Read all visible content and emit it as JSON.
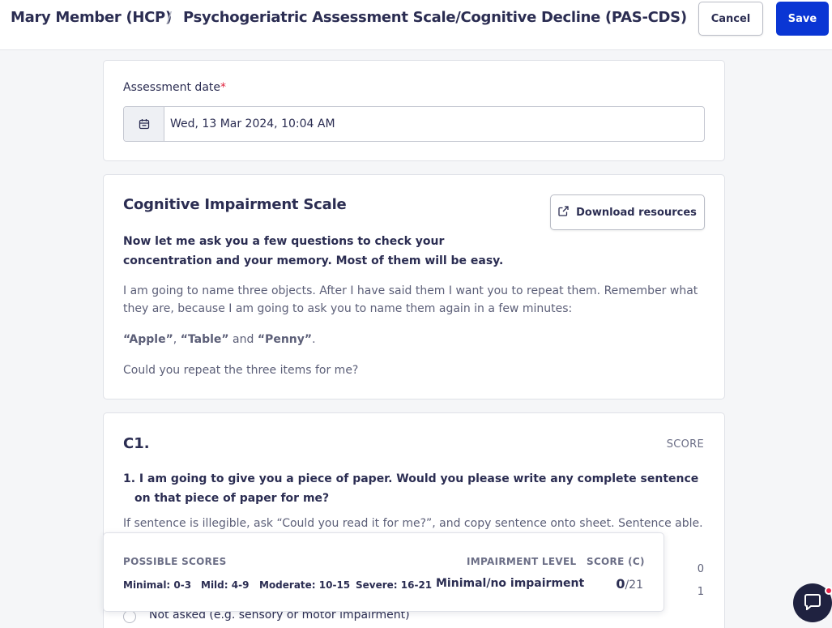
{
  "header": {
    "patient": "Mary Member (HCP)",
    "separator": "/",
    "form_title": "Psychogeriatric Assessment Scale/Cognitive Decline (PAS-CDS)",
    "cancel_label": "Cancel",
    "save_label": "Save"
  },
  "assessment": {
    "label": "Assessment date",
    "required_mark": "*",
    "value": "Wed, 13 Mar 2024, 10:04 AM",
    "icon": "calendar-icon"
  },
  "scale": {
    "title": "Cognitive Impairment Scale",
    "download_label": "Download resources",
    "download_icon": "external-link-icon",
    "intro": "Now let me ask you a few questions to check your concentration and your memory. Most of them will be easy.",
    "paragraph1": "I am going to name three objects. After I have said them I want you to repeat them. Remember what they are, because I am going to ask you to name them again in a few minutes:",
    "objects": [
      "“Apple”",
      "“Table”",
      "“Penny”"
    ],
    "joiner_comma": ", ",
    "joiner_and": " and ",
    "end_punct": ".",
    "paragraph3": "Could you repeat the three items for me?"
  },
  "c1": {
    "title": "C1.",
    "score_header": "SCORE",
    "question": "1. I am going to give you a piece of paper. Would you please write any complete sentence on that piece of paper for me?",
    "instruction": "If sentence is illegible, ask “Could you read it for me?”, and copy sentence onto sheet. Sentence                                                                                           able.",
    "option_scores": [
      "0",
      "1"
    ],
    "option_not_asked": "Not asked (e.g. sensory or motor impairment)"
  },
  "scores_panel": {
    "possible_header": "POSSIBLE SCORES",
    "impairment_header": "IMPAIRMENT LEVEL",
    "score_header": "SCORE (C)",
    "ranges": [
      "Minimal: 0-3",
      "Mild: 4-9",
      "Moderate: 10-15",
      "Severe: 16-21"
    ],
    "impairment_level": "Minimal/no impairment",
    "score": "0",
    "total": "/21"
  },
  "colors": {
    "primary": "#0a36d4",
    "text": "#2b2d52",
    "muted": "#5c5f78",
    "required": "#e0253f",
    "chat": "#1f2240"
  },
  "chat": {
    "icon": "chat-bubble-icon"
  }
}
